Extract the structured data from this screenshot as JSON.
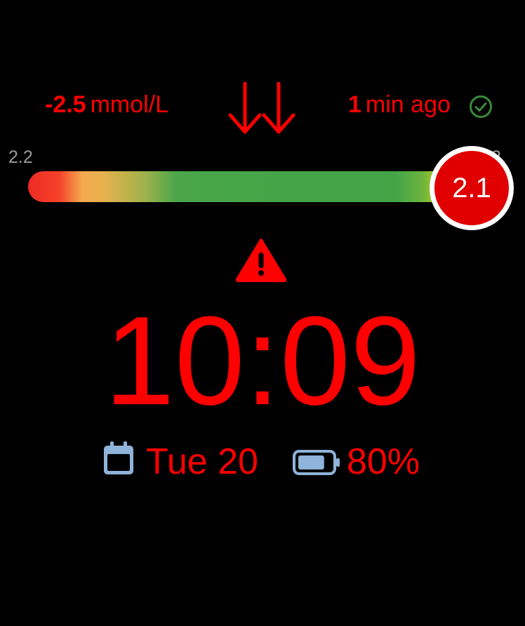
{
  "reading": {
    "delta_value": "-2.5",
    "delta_unit": "mmol/L",
    "trend_icon": "double-arrow-down-icon",
    "last_update_value": "1",
    "last_update_unit": "min ago",
    "status_icon": "check-circle-icon"
  },
  "gauge": {
    "min_label": "2.2",
    "max_label": "2",
    "current_value": "2.1",
    "level_fraction": 1.0
  },
  "alert": {
    "icon": "warning-triangle-icon"
  },
  "clock": {
    "time": "10:09"
  },
  "footer": {
    "date_icon": "calendar-icon",
    "date_text": "Tue 20",
    "battery_icon": "battery-icon",
    "battery_text": "80%",
    "battery_level": 0.8
  },
  "colors": {
    "alert_red": "#ff0000",
    "marker_red": "#e00000",
    "check_green": "#3a8a3a",
    "icon_blue": "#8fb3d9",
    "gauge_green": "#43a548",
    "scale_gray": "#9a9a9a"
  }
}
